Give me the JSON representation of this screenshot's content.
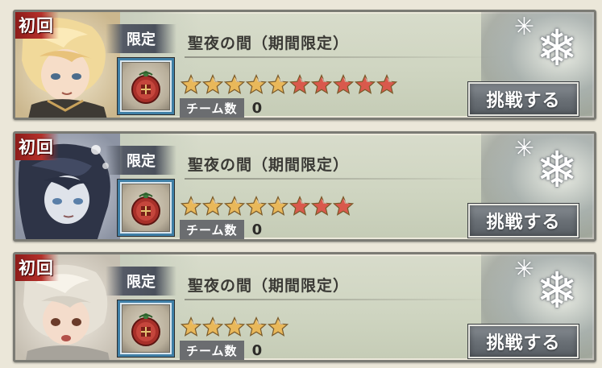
{
  "stages": [
    {
      "first_clear_badge": "初回",
      "limited_badge": "限定",
      "title": "聖夜の間（期間限定）",
      "difficulty_stars": 10,
      "team_count_label": "チーム数",
      "team_count": "0",
      "challenge_button": "挑戦する",
      "portrait_icon": "blonde-character-portrait",
      "item_icon": "christmas-gift-medal-icon"
    },
    {
      "first_clear_badge": "初回",
      "limited_badge": "限定",
      "title": "聖夜の間（期間限定）",
      "difficulty_stars": 8,
      "team_count_label": "チーム数",
      "team_count": "0",
      "challenge_button": "挑戦する",
      "portrait_icon": "dark-hooded-character-portrait",
      "item_icon": "christmas-gift-medal-icon"
    },
    {
      "first_clear_badge": "初回",
      "limited_badge": "限定",
      "title": "聖夜の間（期間限定）",
      "difficulty_stars": 5,
      "team_count_label": "チーム数",
      "team_count": "0",
      "challenge_button": "挑戦する",
      "portrait_icon": "silver-hair-character-portrait",
      "item_icon": "christmas-gift-medal-icon"
    }
  ],
  "colors": {
    "card_background": "#cfd5c1",
    "first_badge_red": "#b5302a",
    "limited_badge": "#545a66",
    "item_frame_blue": "#3f7fa6",
    "button_grey": "#6a7076",
    "star_gold": "#e9b85a",
    "star_red": "#d9594c"
  }
}
